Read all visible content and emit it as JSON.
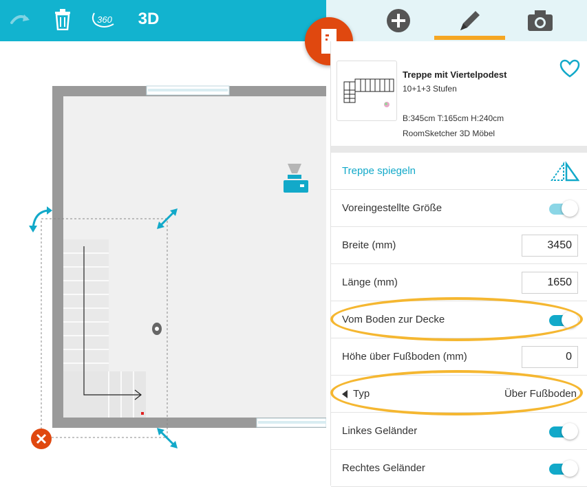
{
  "toolbar": {
    "label_360": "360",
    "label_3d": "3D"
  },
  "panel": {
    "product": {
      "name": "Treppe mit Viertelpodest",
      "steps": "10+1+3 Stufen",
      "dimensions": "B:345cm T:165cm H:240cm",
      "brand": "RoomSketcher 3D Möbel"
    },
    "mirror_label": "Treppe spiegeln",
    "preset_size_label": "Voreingestellte Größe",
    "width_label": "Breite (mm)",
    "width_value": "3450",
    "length_label": "Länge (mm)",
    "length_value": "1650",
    "floor_to_ceiling_label": "Vom Boden zur Decke",
    "height_label": "Höhe über Fußboden (mm)",
    "height_value": "0",
    "type_label": "Typ",
    "type_value": "Über Fußboden",
    "left_railing_label": "Linkes Geländer",
    "right_railing_label": "Rechtes Geländer"
  },
  "colors": {
    "accent": "#12b3cf",
    "highlight": "#f5b731",
    "door_button": "#e0480f",
    "delete_button": "#e0480f"
  },
  "icons": [
    "redo-icon",
    "trash-icon",
    "360-view-icon",
    "plus-icon",
    "pencil-icon",
    "camera-icon",
    "door-icon",
    "heart-icon",
    "mirror-icon",
    "rotate-icon",
    "resize-icon",
    "delete-icon",
    "light-icon",
    "tv-icon"
  ]
}
